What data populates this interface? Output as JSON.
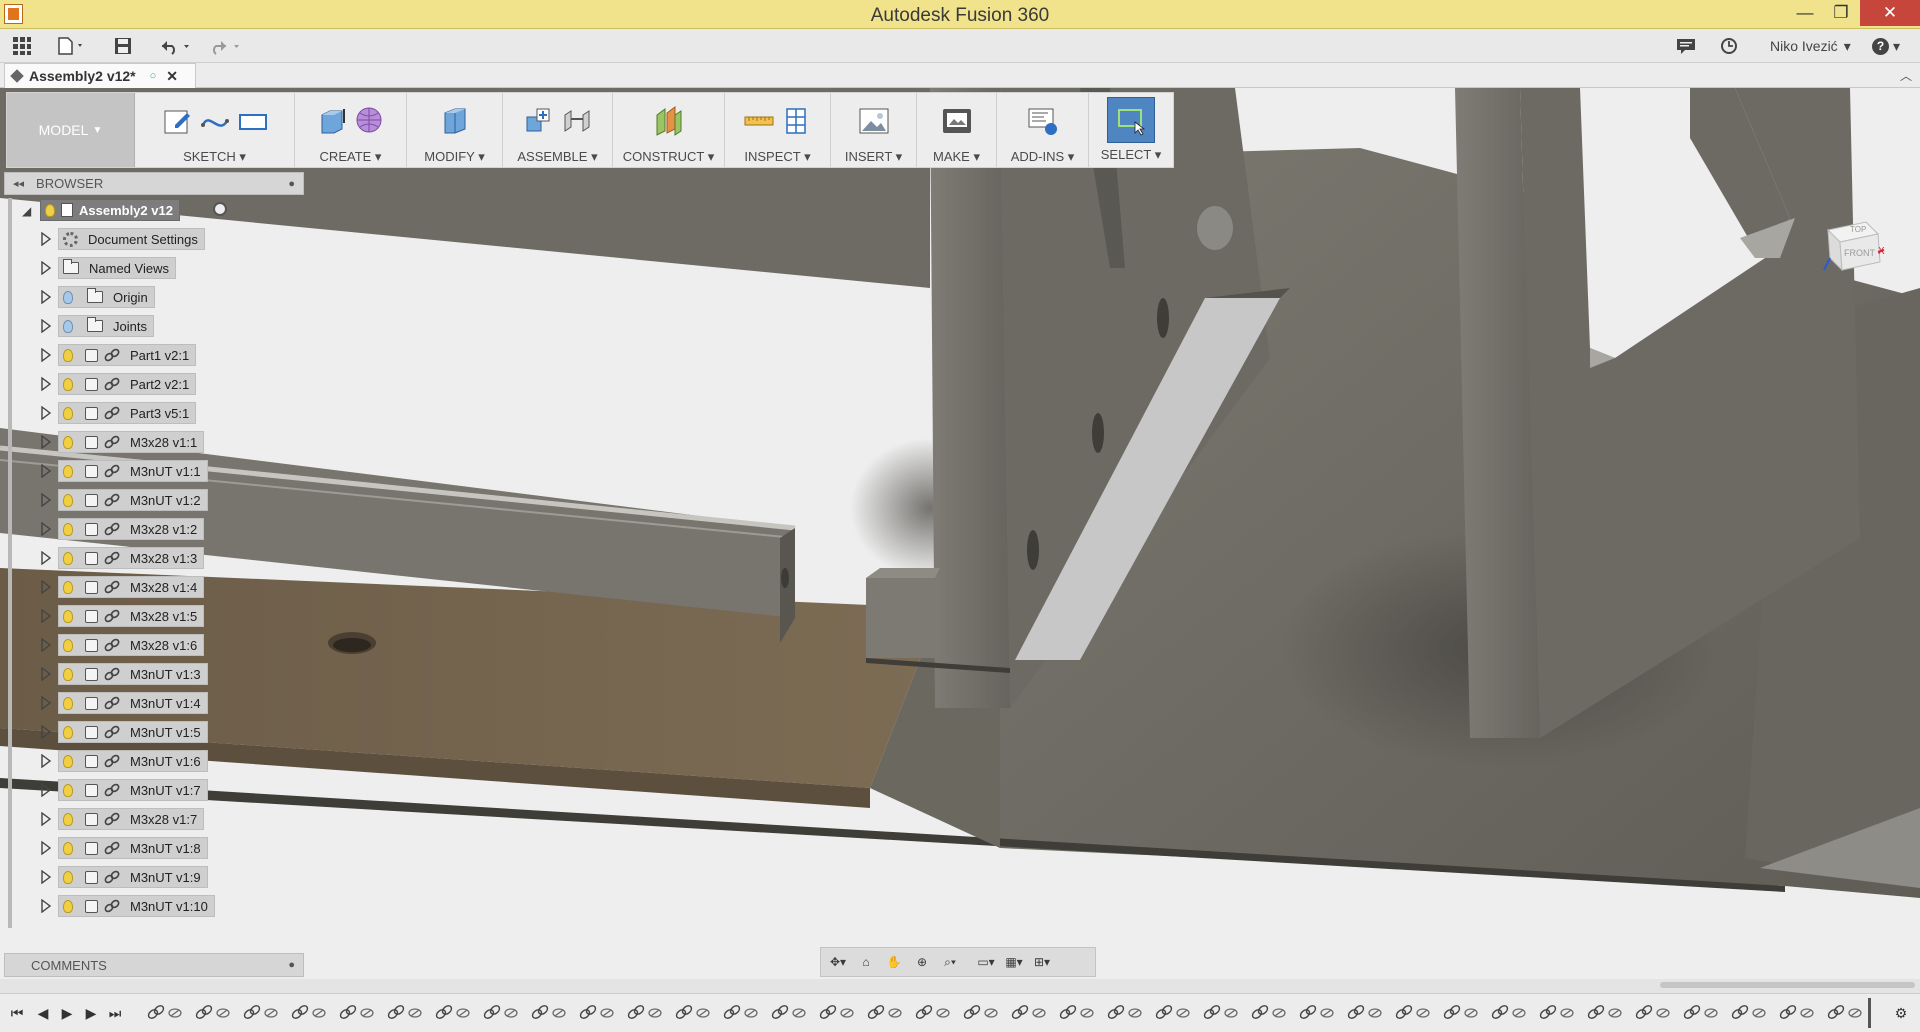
{
  "window": {
    "title": "Autodesk Fusion 360",
    "minimize_glyph": "—",
    "maximize_glyph": "❐",
    "close_glyph": "✕"
  },
  "quick_access": {
    "user_name": "Niko Ivezić",
    "help_label": "?"
  },
  "document": {
    "tab_title": "Assembly2 v12*"
  },
  "toolbar": {
    "workspace_label": "MODEL",
    "groups": [
      {
        "label": "SKETCH",
        "icons": [
          "sketch-create-icon",
          "spline-icon",
          "rectangle-icon"
        ]
      },
      {
        "label": "CREATE",
        "icons": [
          "extrude-icon",
          "form-sphere-icon"
        ]
      },
      {
        "label": "MODIFY",
        "icons": [
          "press-pull-icon"
        ]
      },
      {
        "label": "ASSEMBLE",
        "icons": [
          "new-component-icon",
          "joint-icon"
        ]
      },
      {
        "label": "CONSTRUCT",
        "icons": [
          "offset-plane-icon"
        ]
      },
      {
        "label": "INSPECT",
        "icons": [
          "measure-icon",
          "interference-icon"
        ]
      },
      {
        "label": "INSERT",
        "icons": [
          "insert-image-icon"
        ]
      },
      {
        "label": "MAKE",
        "icons": [
          "3d-print-icon"
        ]
      },
      {
        "label": "ADD-INS",
        "icons": [
          "scripts-icon"
        ]
      },
      {
        "label": "SELECT",
        "icons": [
          "select-window-icon"
        ]
      }
    ]
  },
  "browser": {
    "header": "BROWSER",
    "root": "Assembly2 v12",
    "items": [
      {
        "label": "Document Settings",
        "kind": "settings"
      },
      {
        "label": "Named Views",
        "kind": "folder"
      },
      {
        "label": "Origin",
        "kind": "folder-bulb-off"
      },
      {
        "label": "Joints",
        "kind": "folder-bulb-off"
      },
      {
        "label": "Part1 v2:1",
        "kind": "component"
      },
      {
        "label": "Part2 v2:1",
        "kind": "component"
      },
      {
        "label": "Part3 v5:1",
        "kind": "component"
      },
      {
        "label": "M3x28 v1:1",
        "kind": "component"
      },
      {
        "label": "M3nUT v1:1",
        "kind": "component"
      },
      {
        "label": "M3nUT v1:2",
        "kind": "component"
      },
      {
        "label": "M3x28 v1:2",
        "kind": "component"
      },
      {
        "label": "M3x28 v1:3",
        "kind": "component"
      },
      {
        "label": "M3x28 v1:4",
        "kind": "component"
      },
      {
        "label": "M3x28 v1:5",
        "kind": "component"
      },
      {
        "label": "M3x28 v1:6",
        "kind": "component"
      },
      {
        "label": "M3nUT v1:3",
        "kind": "component"
      },
      {
        "label": "M3nUT v1:4",
        "kind": "component"
      },
      {
        "label": "M3nUT v1:5",
        "kind": "component"
      },
      {
        "label": "M3nUT v1:6",
        "kind": "component"
      },
      {
        "label": "M3nUT v1:7",
        "kind": "component"
      },
      {
        "label": "M3x28 v1:7",
        "kind": "component"
      },
      {
        "label": "M3nUT v1:8",
        "kind": "component"
      },
      {
        "label": "M3nUT v1:9",
        "kind": "component"
      },
      {
        "label": "M3nUT v1:10",
        "kind": "component"
      }
    ]
  },
  "comments": {
    "header": "COMMENTS"
  },
  "viewcube": {
    "top_label": "TOP",
    "front_label": "FRONT",
    "x_label": "X",
    "y_label": "Y",
    "z_label": "Z"
  },
  "timeline": {
    "joint_count": 36
  },
  "colors": {
    "titlebar": "#f0e38b",
    "close_button": "#c7463b",
    "select_accent": "#4f86c2",
    "model_surface": "#6e6c66",
    "highlight_surface": "#7a6b55"
  }
}
